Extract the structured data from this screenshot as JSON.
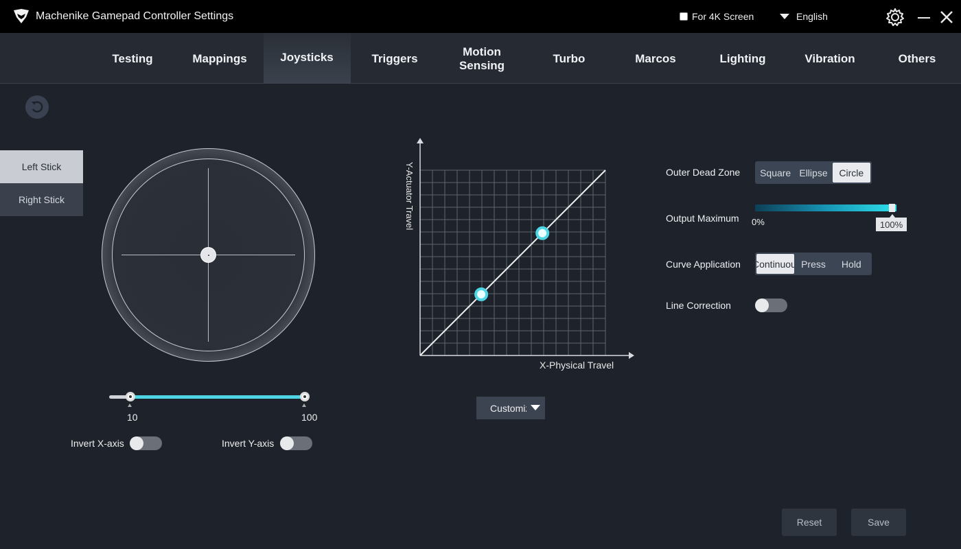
{
  "app": {
    "title": "Machenike Gamepad Controller Settings",
    "for_4k_label": "For 4K Screen",
    "for_4k_checked": false,
    "language": "English"
  },
  "nav": {
    "tabs": [
      "Testing",
      "Mappings",
      "Joysticks",
      "Triggers",
      "Motion\nSensing",
      "Turbo",
      "Marcos",
      "Lighting",
      "Vibration",
      "Others"
    ],
    "active": "Joysticks"
  },
  "sticks": {
    "left_label": "Left Stick",
    "right_label": "Right Stick",
    "selected": "Left Stick"
  },
  "range": {
    "min_value": "10",
    "max_value": "100"
  },
  "invert": {
    "x_label": "Invert X-axis",
    "y_label": "Invert Y-axis",
    "x_on": false,
    "y_on": false
  },
  "curve": {
    "y_label": "Y-Actuator Travel",
    "x_label": "X-Physical Travel",
    "preset": "Customize",
    "grid_divisions": 15,
    "points": [
      [
        0.33,
        0.33
      ],
      [
        0.66,
        0.66
      ]
    ]
  },
  "settings": {
    "outer_dead_zone_label": "Outer Dead Zone",
    "outer_dead_zone_options": [
      "Square",
      "Ellipse",
      "Circle"
    ],
    "outer_dead_zone_selected": "Circle",
    "output_max_label": "Output Maximum",
    "output_min_text": "0%",
    "output_max_text": "100%",
    "output_max_value": 100,
    "curve_application_label": "Curve Application",
    "curve_application_options": [
      "Continuous",
      "Press",
      "Hold"
    ],
    "curve_application_selected": "Continuous",
    "line_correction_label": "Line Correction",
    "line_correction_on": false
  },
  "actions": {
    "reset_label": "Reset",
    "save_label": "Save"
  },
  "colors": {
    "accent": "#4fd6e4",
    "background": "#1e232b",
    "titlebar": "#000000"
  }
}
